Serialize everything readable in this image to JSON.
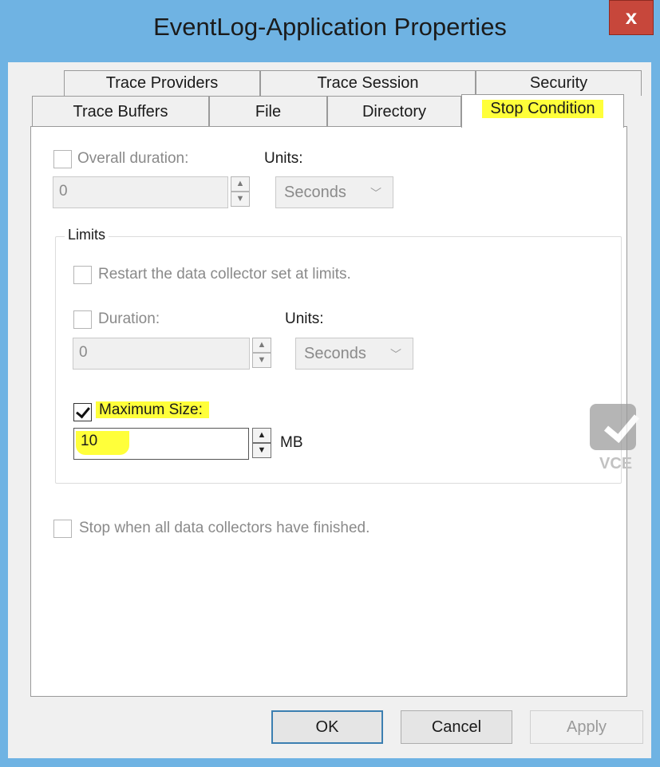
{
  "window": {
    "title": "EventLog-Application Properties",
    "close_label": "x"
  },
  "tabs": {
    "row1": [
      "Trace Providers",
      "Trace Session",
      "Security"
    ],
    "row2": [
      "Trace Buffers",
      "File",
      "Directory",
      "Stop Condition"
    ],
    "active": "Stop Condition"
  },
  "stop_condition": {
    "overall_duration": {
      "label": "Overall duration:",
      "checked": false,
      "value": "0",
      "units_label": "Units:",
      "units_value": "Seconds"
    },
    "limits": {
      "title": "Limits",
      "restart": {
        "label": "Restart the data collector set at limits.",
        "checked": false
      },
      "duration": {
        "label": "Duration:",
        "checked": false,
        "value": "0",
        "units_label": "Units:",
        "units_value": "Seconds"
      },
      "maximum_size": {
        "label": "Maximum Size:",
        "checked": true,
        "value": "10",
        "unit": "MB"
      }
    },
    "stop_when_finished": {
      "label": "Stop when all data collectors have finished.",
      "checked": false
    }
  },
  "buttons": {
    "ok": "OK",
    "cancel": "Cancel",
    "apply": "Apply"
  },
  "watermark": {
    "text": "VCE",
    "icon": "check-icon"
  },
  "colors": {
    "highlight": "#ffff3a",
    "frame": "#6fb3e3",
    "close": "#c7473b"
  }
}
